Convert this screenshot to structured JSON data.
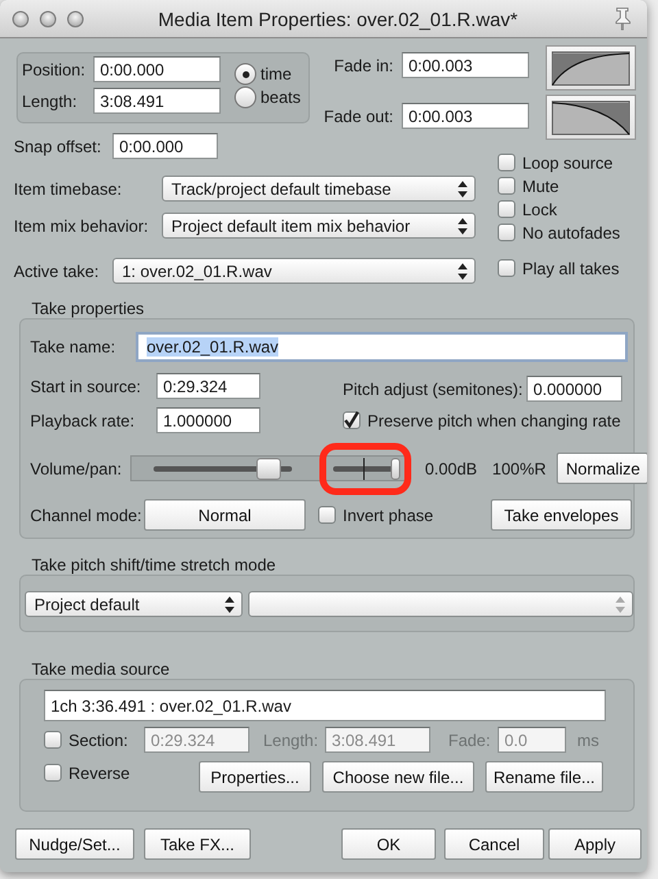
{
  "window": {
    "title": "Media Item Properties:  over.02_01.R.wav*"
  },
  "position": {
    "label": "Position:",
    "value": "0:00.000"
  },
  "length": {
    "label": "Length:",
    "value": "3:08.491"
  },
  "timebase_mode": [
    {
      "label": "time",
      "selected": true
    },
    {
      "label": "beats",
      "selected": false
    }
  ],
  "fade_in": {
    "label": "Fade in:",
    "value": "0:00.003"
  },
  "fade_out": {
    "label": "Fade out:",
    "value": "0:00.003"
  },
  "snap_offset": {
    "label": "Snap offset:",
    "value": "0:00.000"
  },
  "item_timebase": {
    "label": "Item timebase:",
    "value": "Track/project default timebase"
  },
  "item_mix_behavior": {
    "label": "Item mix behavior:",
    "value": "Project default item mix behavior"
  },
  "active_take": {
    "label": "Active take:",
    "value": "1: over.02_01.R.wav"
  },
  "flags": [
    {
      "label": "Loop source",
      "checked": false
    },
    {
      "label": "Mute",
      "checked": false
    },
    {
      "label": "Lock",
      "checked": false
    },
    {
      "label": "No autofades",
      "checked": false
    }
  ],
  "play_all_takes": {
    "label": "Play all takes",
    "checked": false
  },
  "take_properties": {
    "title": "Take properties",
    "take_name": {
      "label": "Take name:",
      "value": "over.02_01.R.wav",
      "selected": true
    },
    "start_in_source": {
      "label": "Start in source:",
      "value": "0:29.324"
    },
    "playback_rate": {
      "label": "Playback rate:",
      "value": "1.000000"
    },
    "pitch_adjust": {
      "label": "Pitch adjust (semitones):",
      "value": "0.000000"
    },
    "preserve_pitch": {
      "label": "Preserve pitch when changing rate",
      "checked": true
    },
    "volume_pan": {
      "label": "Volume/pan:",
      "volume": {
        "level": 0.82
      },
      "pan": {
        "level": 1.0,
        "highlighted": true
      },
      "volume_reading": "0.00dB",
      "pan_reading": "100%R"
    },
    "normalize_button": "Normalize",
    "channel_mode": {
      "label": "Channel mode:",
      "value": "Normal"
    },
    "invert_phase": {
      "label": "Invert phase",
      "checked": false
    },
    "take_envelopes_button": "Take envelopes"
  },
  "pitch_mode": {
    "title": "Take pitch shift/time stretch mode",
    "mode": "Project default"
  },
  "media_source": {
    "title": "Take media source",
    "info": "1ch 3:36.491 : over.02_01.R.wav",
    "section": {
      "label": "Section:",
      "checked": false,
      "start": "0:29.324",
      "length_label": "Length:",
      "length": "3:08.491",
      "fade_label": "Fade:",
      "fade": "0.0",
      "unit": "ms"
    },
    "reverse": {
      "label": "Reverse",
      "checked": false
    },
    "buttons": [
      "Properties...",
      "Choose new file...",
      "Rename file..."
    ]
  },
  "footer_buttons": [
    "Nudge/Set...",
    "Take FX...",
    "OK",
    "Cancel",
    "Apply"
  ]
}
